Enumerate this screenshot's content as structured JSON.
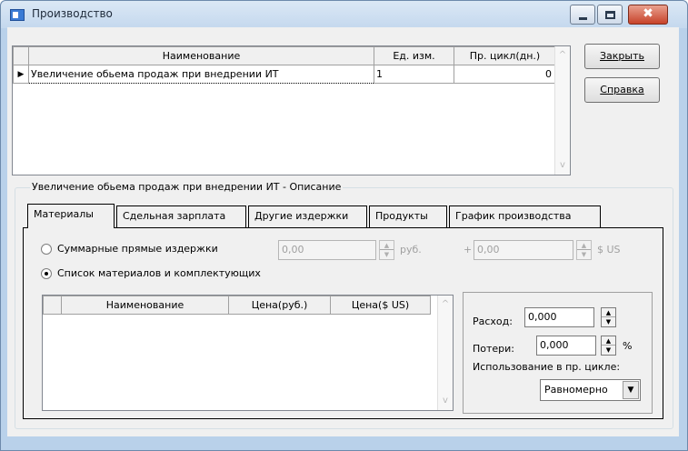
{
  "window": {
    "title": "Производство",
    "icon": "app-icon"
  },
  "title_buttons": {
    "minimize": "minimize-icon",
    "maximize": "maximize-icon",
    "close": "✖"
  },
  "top_grid": {
    "columns": [
      "Наименование",
      "Ед. изм.",
      "Пр. цикл(дн.)"
    ],
    "rows": [
      {
        "indicator": "▶",
        "name": "Увеличение обьема продаж при внедрении ИТ",
        "unit": "1",
        "cycle": "0"
      }
    ]
  },
  "buttons": {
    "close": "Закрыть",
    "help": "Справка"
  },
  "description_group": {
    "caption": "Увеличение обьема продаж при внедрении ИТ - Описание"
  },
  "tabs": [
    {
      "label": "Материалы",
      "active": true
    },
    {
      "label": "Сдельная зарплата",
      "active": false
    },
    {
      "label": "Другие издержки",
      "active": false
    },
    {
      "label": "Продукты",
      "active": false
    },
    {
      "label": "График производства",
      "active": false
    }
  ],
  "materials": {
    "radio_total": "Суммарные прямые издержки",
    "radio_list": "Список материалов и комплектующих",
    "selected": "radio_list",
    "total_rub_value": "0,00",
    "rub_unit": "руб.",
    "plus_sign": "+",
    "total_usd_value": "0,00",
    "usd_unit": "$ US",
    "grid_columns": [
      "Наименование",
      "Цена(руб.)",
      "Цена($ US)"
    ],
    "consumption_label": "Расход:",
    "consumption_value": "0,000",
    "loss_label": "Потери:",
    "loss_value": "0,000",
    "loss_unit": "%",
    "usage_label": "Использование в пр. цикле:",
    "usage_value": "Равномерно"
  },
  "colors": {
    "window_frame": "#b9d1ea",
    "client_bg": "#f0f0f0",
    "close_button": "#c7432a"
  }
}
